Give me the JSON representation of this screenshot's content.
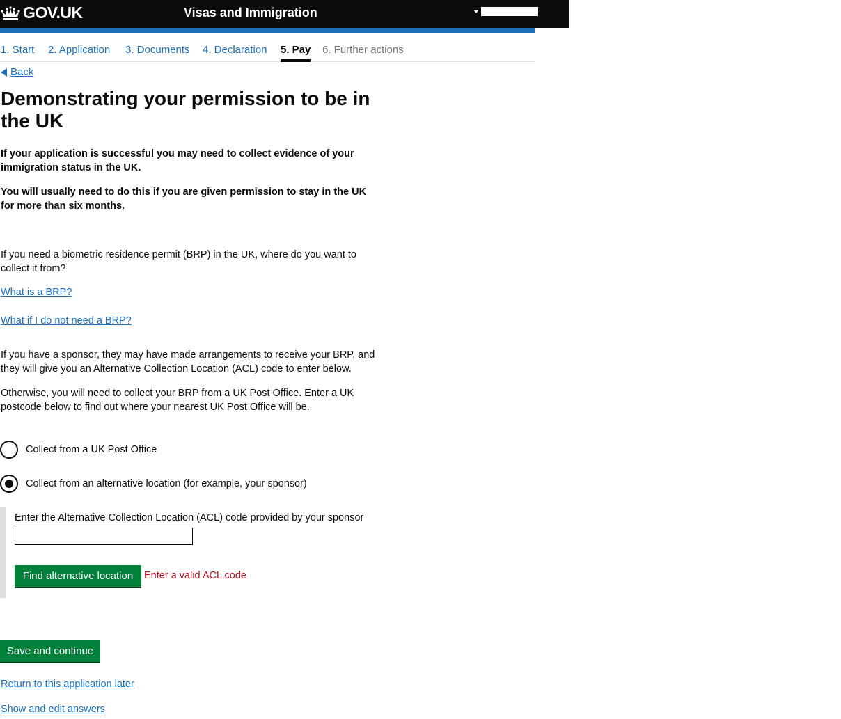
{
  "header": {
    "logo_text": "GOV.UK",
    "service_name": "Visas and Immigration",
    "colors": {
      "background": "#0b0c0c",
      "accent_bar": "#1d70b8"
    }
  },
  "steps": [
    {
      "label": "1. Start",
      "state": "done"
    },
    {
      "label": "2. Application",
      "state": "done"
    },
    {
      "label": "3. Documents",
      "state": "done"
    },
    {
      "label": "4. Declaration",
      "state": "done"
    },
    {
      "label": "5. Pay",
      "state": "current"
    },
    {
      "label": "6. Further actions",
      "state": "future"
    }
  ],
  "back_label": "Back",
  "page_title": "Demonstrating your permission to be in the UK",
  "lead_paragraphs": [
    "If your application is successful you may need to collect evidence of your immigration status in the UK.",
    "You will usually need to do this if you are given permission to stay in the UK for more than six months."
  ],
  "question": "If you need a biometric residence permit (BRP) in the UK, where do you want to collect it from?",
  "links": {
    "what_is_brp": "What is a BRP?",
    "no_brp": "What if I do not need a BRP?"
  },
  "info_paragraphs": [
    "If you have a sponsor, they may have made arrangements to receive your BRP, and they will give you an Alternative Collection Location (ACL) code to enter below.",
    "Otherwise, you will need to collect your BRP from a UK Post Office. Enter a UK postcode below to find out where your nearest UK Post Office will be."
  ],
  "radio_options": [
    {
      "label": "Collect from a UK Post Office",
      "selected": false
    },
    {
      "label": "Collect from an alternative location (for example, your sponsor)",
      "selected": true
    }
  ],
  "acl": {
    "label": "Enter the Alternative Collection Location (ACL) code provided by your sponsor",
    "value": "",
    "button_label": "Find alternative location",
    "error": "Enter a valid ACL code"
  },
  "actions": {
    "save_label": "Save and continue",
    "return_later": "Return to this application later",
    "show_edit": "Show and edit answers"
  },
  "colors": {
    "link": "#1d70b8",
    "button": "#00823b",
    "error": "#b10e1e"
  }
}
